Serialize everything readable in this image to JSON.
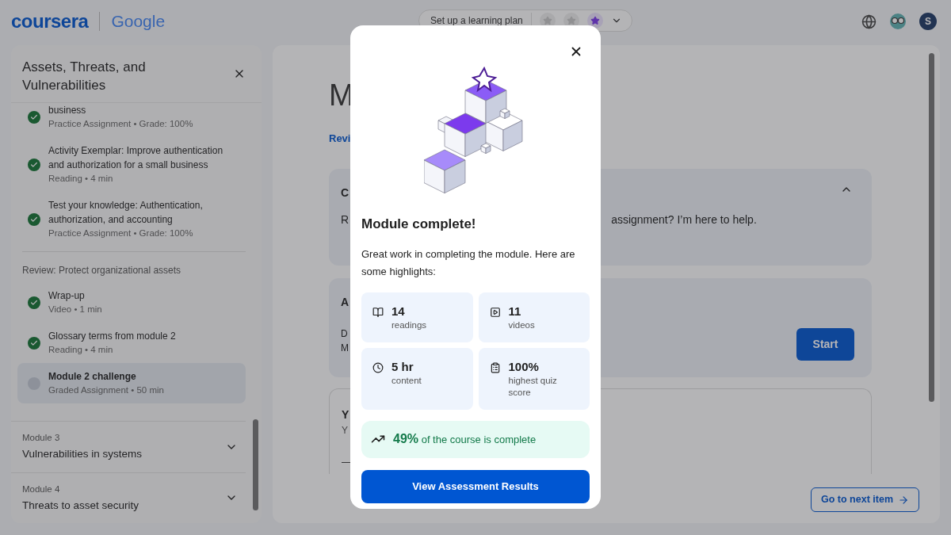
{
  "header": {
    "logo": "coursera",
    "partner": "Google",
    "plan_button": "Set up a learning plan",
    "goal_stars": [
      {
        "filled": false
      },
      {
        "filled": false
      },
      {
        "filled": true
      }
    ],
    "avatar_initial": "S"
  },
  "sidebar": {
    "title": "Assets, Threats, and Vulnerabilities",
    "groups": [
      {
        "items": [
          {
            "title": "business",
            "meta": "Practice Assignment • Grade: 100%",
            "completed": true,
            "selected": false
          },
          {
            "title": "Activity Exemplar: Improve authentication and authorization for a small business",
            "meta": "Reading • 4 min",
            "completed": true,
            "selected": false
          },
          {
            "title": "Test your knowledge: Authentication, authorization, and accounting",
            "meta": "Practice Assignment • Grade: 100%",
            "completed": true,
            "selected": false
          }
        ]
      },
      {
        "heading": "Review: Protect organizational assets",
        "items": [
          {
            "title": "Wrap-up",
            "meta": "Video • 1 min",
            "completed": true,
            "selected": false
          },
          {
            "title": "Glossary terms from module 2",
            "meta": "Reading • 4 min",
            "completed": true,
            "selected": false
          },
          {
            "title": "Module 2 challenge",
            "meta": "Graded Assignment • 50 min",
            "completed": false,
            "selected": true
          }
        ]
      }
    ],
    "modules": [
      {
        "label": "Module 3",
        "title": "Vulnerabilities in systems",
        "expanded": false
      },
      {
        "label": "Module 4",
        "title": "Threats to asset security",
        "expanded": false
      }
    ]
  },
  "main": {
    "heading": "M",
    "link": "Revi",
    "coach_card": {
      "title": "C",
      "text_left": "R",
      "text_right": "assignment? I’m here to help.",
      "expanded": true
    },
    "assignment_card": {
      "title": "A",
      "line_1": "D",
      "line_2": "M",
      "button": "Start"
    },
    "result_card": {
      "title": "Y",
      "line": "Y",
      "dash": "—"
    },
    "next_button": "Go to next item"
  },
  "modal": {
    "title": "Module complete!",
    "text": "Great work in completing the module. Here are some highlights:",
    "stats": [
      {
        "kind": "readings",
        "value": "14",
        "label": "readings"
      },
      {
        "kind": "videos",
        "value": "11",
        "label": "videos"
      },
      {
        "kind": "time",
        "value": "5 hr",
        "label": "content"
      },
      {
        "kind": "quiz",
        "value": "100%",
        "label": "highest quiz score"
      }
    ],
    "progress": {
      "percent": "49%",
      "text": "of the course is complete"
    },
    "button": "View Assessment Results"
  }
}
